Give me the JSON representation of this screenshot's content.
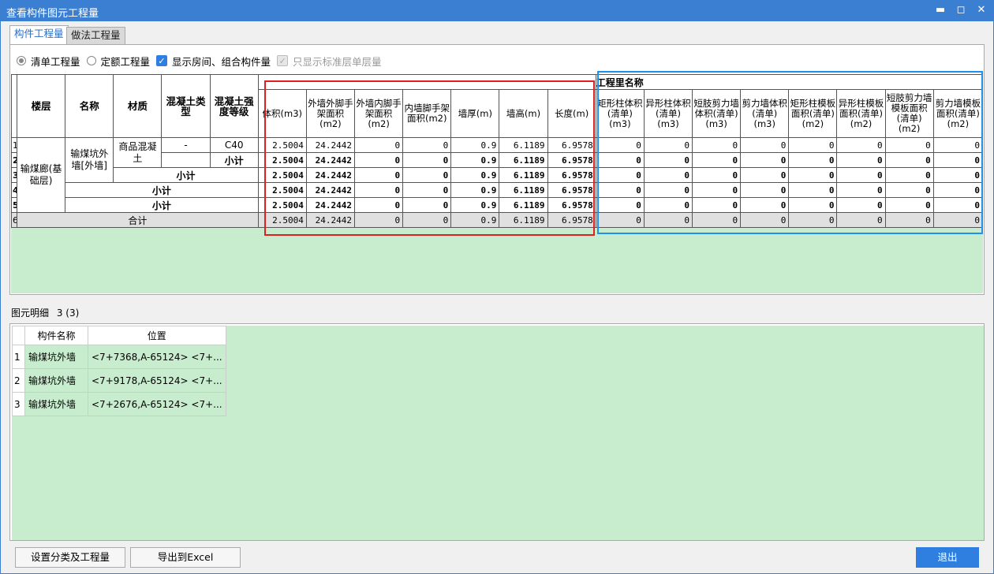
{
  "window": {
    "title": "查看构件图元工程量",
    "min": "▬",
    "max": "◻",
    "close": "✕"
  },
  "tabs": [
    {
      "label": "构件工程量"
    },
    {
      "label": "做法工程量"
    }
  ],
  "options": {
    "list_qty": "清单工程量",
    "quota_qty": "定额工程量",
    "show_rooms": "显示房间、组合构件量",
    "std_floor_only": "只显示标准层单层量"
  },
  "grid": {
    "group_header": "工程里名称",
    "headers": [
      "楼层",
      "名称",
      "材质",
      "混凝土类型",
      "混凝土强度等级",
      "体积(m3)",
      "外墙外脚手架面积(m2)",
      "外墙内脚手架面积(m2)",
      "内墙脚手架面积(m2)",
      "墙厚(m)",
      "墙高(m)",
      "长度(m)",
      "矩形柱体积(清单)(m3)",
      "异形柱体积(清单)(m3)",
      "短肢剪力墙体积(清单)(m3)",
      "剪力墙体积(清单)(m3)",
      "矩形柱模板面积(清单)(m2)",
      "异形柱模板面积(清单)(m2)",
      "短肢剪力墙模板面积(清单)(m2)",
      "剪力墙模板面积(清单)(m2)"
    ],
    "row_numbers": [
      "1",
      "2",
      "3",
      "4",
      "5",
      "6"
    ],
    "floor": "输煤廊(基础层)",
    "name": "输煤坑外墙[外墙]",
    "material": "商品混凝土",
    "concrete_type": "-",
    "grade": "C40",
    "subtotal": "小计",
    "total": "合计",
    "rows": [
      [
        "2.5004",
        "24.2442",
        "0",
        "0",
        "0.9",
        "6.1189",
        "6.9578",
        "0",
        "0",
        "0",
        "0",
        "0",
        "0",
        "0",
        "0"
      ],
      [
        "2.5004",
        "24.2442",
        "0",
        "0",
        "0.9",
        "6.1189",
        "6.9578",
        "0",
        "0",
        "0",
        "0",
        "0",
        "0",
        "0",
        "0"
      ],
      [
        "2.5004",
        "24.2442",
        "0",
        "0",
        "0.9",
        "6.1189",
        "6.9578",
        "0",
        "0",
        "0",
        "0",
        "0",
        "0",
        "0",
        "0"
      ],
      [
        "2.5004",
        "24.2442",
        "0",
        "0",
        "0.9",
        "6.1189",
        "6.9578",
        "0",
        "0",
        "0",
        "0",
        "0",
        "0",
        "0",
        "0"
      ],
      [
        "2.5004",
        "24.2442",
        "0",
        "0",
        "0.9",
        "6.1189",
        "6.9578",
        "0",
        "0",
        "0",
        "0",
        "0",
        "0",
        "0",
        "0"
      ],
      [
        "2.5004",
        "24.2442",
        "0",
        "0",
        "0.9",
        "6.1189",
        "6.9578",
        "0",
        "0",
        "0",
        "0",
        "0",
        "0",
        "0",
        "0"
      ]
    ]
  },
  "detail": {
    "title": "图元明细",
    "count": "3 (3)",
    "headers": [
      "构件名称",
      "位置"
    ],
    "rows": [
      {
        "num": "1",
        "name": "输煤坑外墙",
        "pos": "<7+7368,A-65124> <7+..."
      },
      {
        "num": "2",
        "name": "输煤坑外墙",
        "pos": "<7+9178,A-65124> <7+..."
      },
      {
        "num": "3",
        "name": "输煤坑外墙",
        "pos": "<7+2676,A-65124> <7+..."
      }
    ]
  },
  "buttons": {
    "set_category": "设置分类及工程量",
    "export": "导出到Excel",
    "exit": "退出"
  },
  "colors": {
    "titlebar": "#3b7fd3",
    "grid_empty": "#c8edce",
    "red_highlight": "#e02020",
    "blue_highlight": "#1e90ee"
  }
}
